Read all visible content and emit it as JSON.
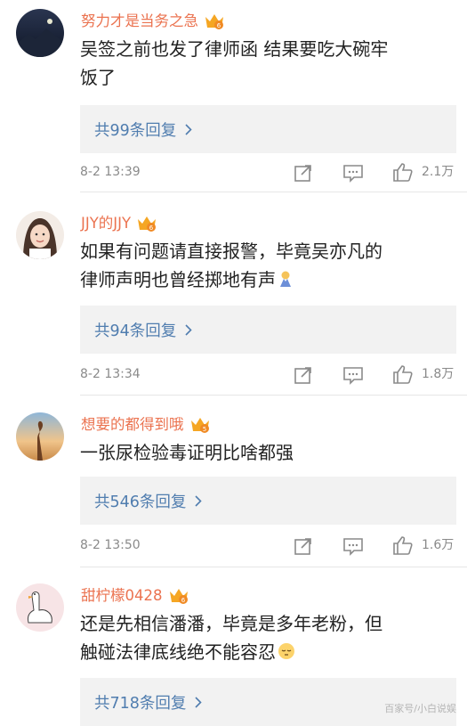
{
  "comments": [
    {
      "username": "努力才是当务之急",
      "text_lines": [
        "吴签之前也发了律师函 结果要吃大碗牢",
        "饭了"
      ],
      "reply_label": "共99条回复",
      "time": "8-2 13:39",
      "likes": "2.1万",
      "avatar": "mountain-night-avatar"
    },
    {
      "username": "JJY的JJY",
      "text_lines": [
        "如果有问题请直接报警，毕竟吴亦凡的",
        "律师声明也曾经掷地有声"
      ],
      "reply_label": "共94条回复",
      "time": "8-2 13:34",
      "likes": "1.8万",
      "avatar": "girl-photo-avatar"
    },
    {
      "username": "想要的都得到哦",
      "text_lines": [
        "一张尿检验毒证明比啥都强"
      ],
      "reply_label": "共546条回复",
      "time": "8-2 13:50",
      "likes": "1.6万",
      "avatar": "sunset-figure-avatar"
    },
    {
      "username": "甜柠檬0428",
      "text_lines": [
        "还是先相信潘潘，毕竟是多年老粉，但",
        "触碰法律底线绝不能容忍"
      ],
      "reply_label": "共718条回复",
      "time": "",
      "likes": "",
      "avatar": "cartoon-goose-avatar"
    }
  ],
  "colors": {
    "username": "#eb7350",
    "reply_link": "#507daf",
    "meta": "#8a8a8a",
    "crown": "#f5a623"
  },
  "watermark": "百家号/小白说娱"
}
